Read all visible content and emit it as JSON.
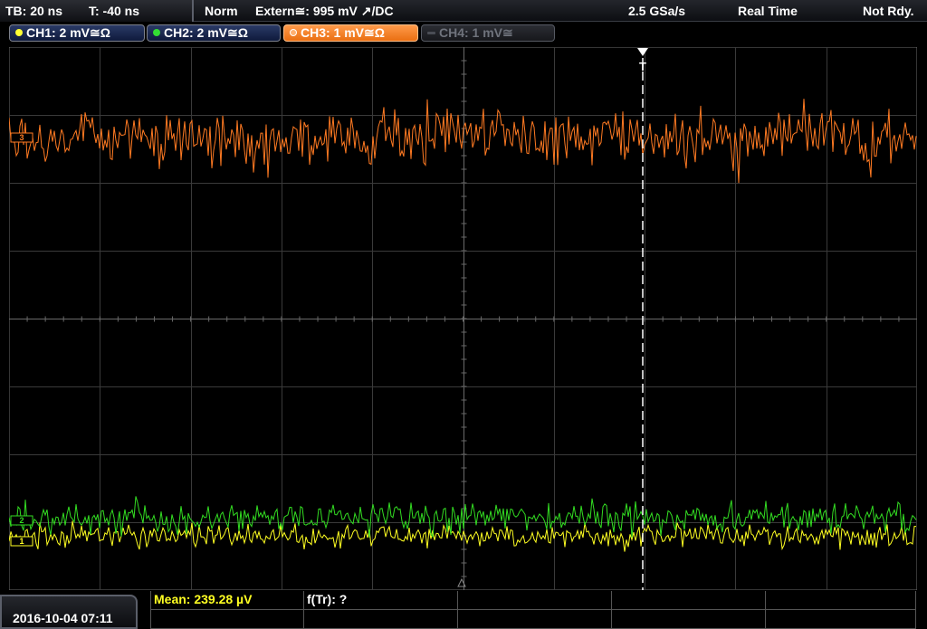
{
  "topbar": {
    "timebase": "TB: 20 ns",
    "trigger_time": "T: -40 ns",
    "trigger_mode": "Norm",
    "trigger_source": "Extern≅: 995 mV ↗/DC",
    "sample_rate": "2.5 GSa/s",
    "acq_mode": "Real Time",
    "status": "Not Rdy."
  },
  "channels": [
    {
      "label": "CH1: 2 mV≅Ω",
      "color": "#ffff33",
      "state": "on"
    },
    {
      "label": "CH2: 2 mV≅Ω",
      "color": "#33dd33",
      "state": "on"
    },
    {
      "label": "CH3: 1 mV≅Ω",
      "color": "#ff8a2a",
      "state": "active"
    },
    {
      "label": "CH4: 1 mV≅",
      "color": "#6f737c",
      "state": "off"
    }
  ],
  "markers": {
    "ch3": "3",
    "ch1": "1",
    "ch2": "2",
    "trigger": "T"
  },
  "measurements": {
    "mean": "Mean: 239.28 µV",
    "freq": "f(Tr): ?"
  },
  "datetime": "2016-10-04 07:11",
  "colors": {
    "ch1": "#ffff22",
    "ch2": "#33dd22",
    "ch3": "#ff7a22",
    "grid": "#3a3a3a",
    "grid_center": "#6a6a6a"
  }
}
